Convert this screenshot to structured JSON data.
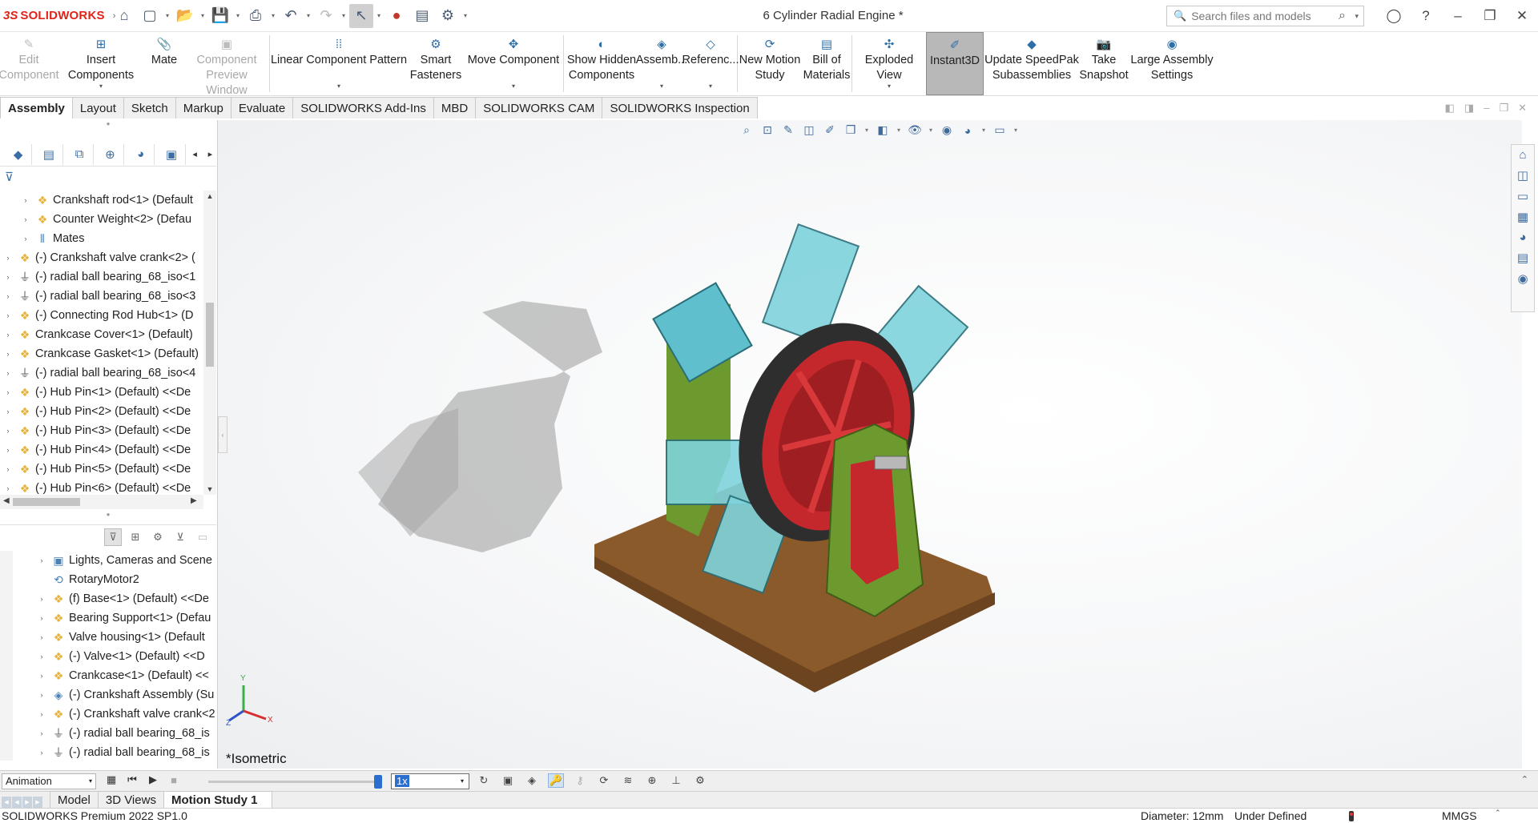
{
  "app": {
    "logo_ds": "3S",
    "logo_text": "SOLIDWORKS",
    "document_title": "6 Cylinder Radial Engine *"
  },
  "search": {
    "placeholder": "Search files and models"
  },
  "ribbon": [
    {
      "label": "Edit Component",
      "icon": "edit-component-icon",
      "disabled": true
    },
    {
      "label": "Insert Components",
      "icon": "insert-components-icon",
      "dropdown": true
    },
    {
      "label": "Mate",
      "icon": "paperclip-icon"
    },
    {
      "label": "Component Preview Window",
      "icon": "preview-window-icon",
      "disabled": true
    },
    {
      "label": "Linear Component Pattern",
      "icon": "pattern-icon",
      "dropdown": true
    },
    {
      "label": "Smart Fasteners",
      "icon": "smart-fasteners-icon"
    },
    {
      "label": "Move Component",
      "icon": "move-component-icon",
      "dropdown": true
    },
    {
      "label": "Show Hidden Components",
      "icon": "show-hidden-icon"
    },
    {
      "label": "Assemb...",
      "icon": "assembly-features-icon",
      "dropdown": true
    },
    {
      "label": "Referenc...",
      "icon": "reference-geometry-icon",
      "dropdown": true
    },
    {
      "label": "New Motion Study",
      "icon": "motion-study-icon"
    },
    {
      "label": "Bill of Materials",
      "icon": "bom-icon"
    },
    {
      "label": "Exploded View",
      "icon": "exploded-view-icon",
      "dropdown": true
    },
    {
      "label": "Instant3D",
      "icon": "instant3d-icon",
      "active": true
    },
    {
      "label": "Update SpeedPak Subassemblies",
      "icon": "speedpak-icon"
    },
    {
      "label": "Take Snapshot",
      "icon": "camera-icon"
    },
    {
      "label": "Large Assembly Settings",
      "icon": "large-assembly-icon"
    }
  ],
  "tabs": [
    "Assembly",
    "Layout",
    "Sketch",
    "Markup",
    "Evaluate",
    "SOLIDWORKS Add-Ins",
    "MBD",
    "SOLIDWORKS CAM",
    "SOLIDWORKS Inspection"
  ],
  "feature_tree": [
    {
      "label": "Crankshaft rod<1> (Default",
      "indent": 1,
      "icon": "part"
    },
    {
      "label": "Counter Weight<2> (Defau",
      "indent": 1,
      "icon": "part"
    },
    {
      "label": "Mates",
      "indent": 1,
      "icon": "mate"
    },
    {
      "label": "(-) Crankshaft valve crank<2> (",
      "indent": 0,
      "icon": "part"
    },
    {
      "label": "(-) radial ball bearing_68_iso<1",
      "indent": 0,
      "icon": "bearing"
    },
    {
      "label": "(-) radial ball bearing_68_iso<3",
      "indent": 0,
      "icon": "bearing"
    },
    {
      "label": "(-) Connecting Rod Hub<1> (D",
      "indent": 0,
      "icon": "part"
    },
    {
      "label": "Crankcase Cover<1> (Default)",
      "indent": 0,
      "icon": "part"
    },
    {
      "label": "Crankcase Gasket<1> (Default)",
      "indent": 0,
      "icon": "part"
    },
    {
      "label": "(-) radial ball bearing_68_iso<4",
      "indent": 0,
      "icon": "bearing"
    },
    {
      "label": "(-) Hub Pin<1> (Default) <<De",
      "indent": 0,
      "icon": "part"
    },
    {
      "label": "(-) Hub Pin<2> (Default) <<De",
      "indent": 0,
      "icon": "part"
    },
    {
      "label": "(-) Hub Pin<3> (Default) <<De",
      "indent": 0,
      "icon": "part"
    },
    {
      "label": "(-) Hub Pin<4> (Default) <<De",
      "indent": 0,
      "icon": "part"
    },
    {
      "label": "(-) Hub Pin<5> (Default) <<De",
      "indent": 0,
      "icon": "part"
    },
    {
      "label": "(-) Hub Pin<6> (Default) <<De",
      "indent": 0,
      "icon": "part"
    }
  ],
  "motion_tree": [
    {
      "label": "Lights, Cameras and Scene",
      "icon": "scene",
      "expand": true
    },
    {
      "label": "RotaryMotor2",
      "icon": "motor",
      "expand": false
    },
    {
      "label": "(f) Base<1> (Default) <<De",
      "icon": "part",
      "expand": true
    },
    {
      "label": "Bearing Support<1> (Defau",
      "icon": "part",
      "expand": true
    },
    {
      "label": "Valve housing<1> (Default",
      "icon": "part",
      "expand": true
    },
    {
      "label": "(-) Valve<1> (Default) <<D",
      "icon": "part",
      "expand": true
    },
    {
      "label": "Crankcase<1> (Default) <<",
      "icon": "part",
      "expand": true
    },
    {
      "label": "(-) Crankshaft Assembly (Su",
      "icon": "assembly",
      "expand": true
    },
    {
      "label": "(-) Crankshaft valve crank<2",
      "icon": "part",
      "expand": true
    },
    {
      "label": "(-) radial ball bearing_68_is",
      "icon": "bearing",
      "expand": true
    },
    {
      "label": "(-) radial ball bearing_68_is",
      "icon": "bearing",
      "expand": true
    }
  ],
  "viewport": {
    "view_name": "*Isometric"
  },
  "motion": {
    "study_type": "Animation",
    "playback_speed": "1x",
    "tabs": [
      "Model",
      "3D Views",
      "Motion Study 1"
    ]
  },
  "status": {
    "product": "SOLIDWORKS Premium 2022 SP1.0",
    "measure": "Diameter: 12mm",
    "state": "Under Defined",
    "units": "MMGS"
  }
}
